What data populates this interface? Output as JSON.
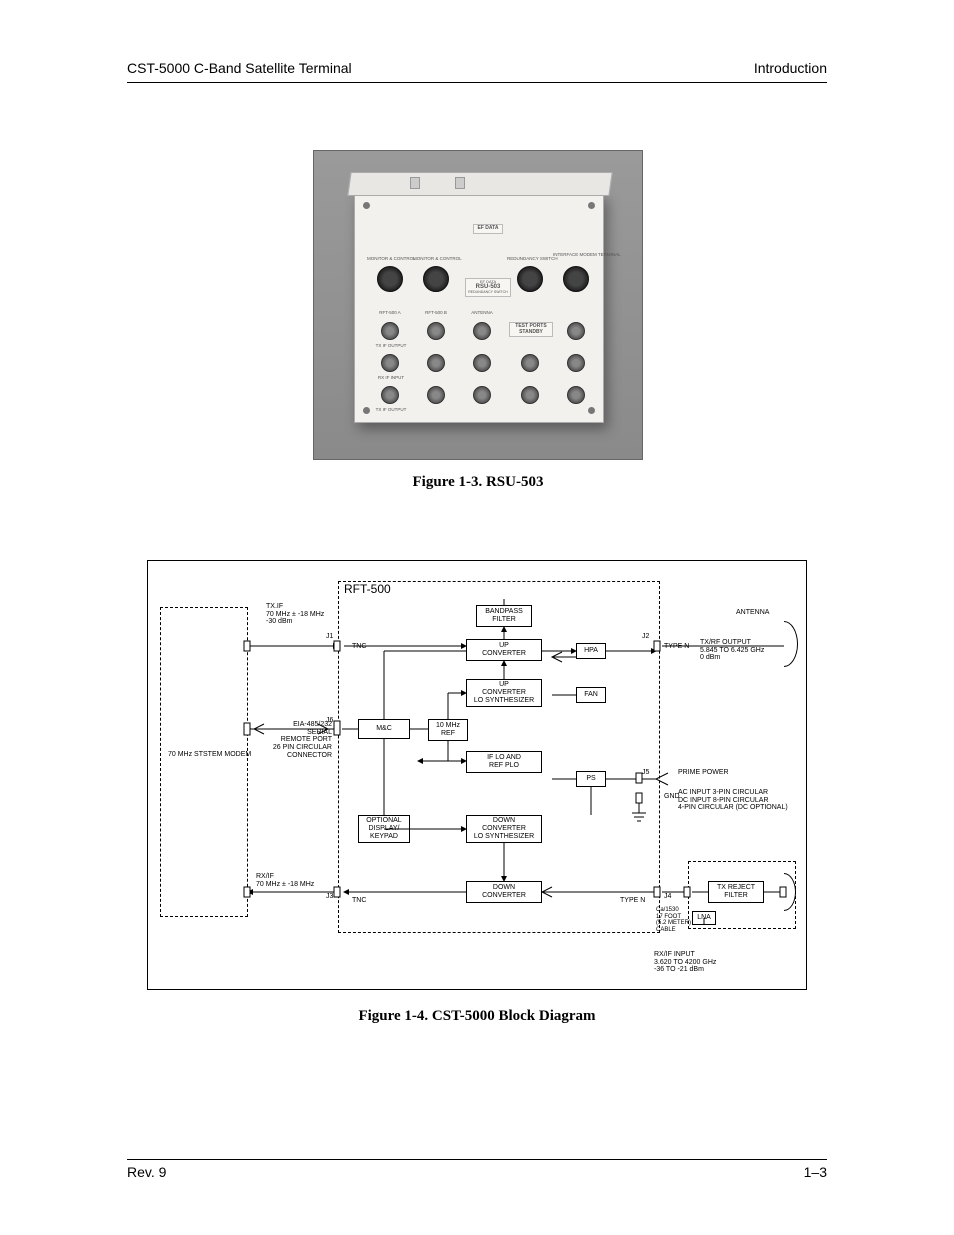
{
  "header": {
    "left": "CST-5000 C-Band Satellite Terminal",
    "right": "Introduction"
  },
  "figure1": {
    "caption": "Figure 1-3.  RSU-503",
    "device": {
      "brand": "EF DATA",
      "model": "RSU-503",
      "subtitle": "REDUNDANCY SWITCH",
      "cols": {
        "a": "RFT-500  A",
        "b": "RFT-500  B",
        "ant": "ANTENNA",
        "tp": "TEST PORTS STANDBY",
        "if1": "INTERFACE MODEM TERMINAL",
        "if2": ""
      },
      "rows": {
        "tx": "TX  IF OUTPUT",
        "rx": "RX  IF INPUT",
        "txo": "TX  IF OUTPUT",
        "mc": "MONITOR & CONTROL"
      }
    }
  },
  "figure2": {
    "caption": "Figure 1-4.  CST-5000 Block Diagram",
    "title": "RFT-500",
    "left": {
      "modem": "70 MHz STSTEM MODEM",
      "txif": "TX.IF\n70 MHz ± -18 MHz\n-30 dBm",
      "serial": "EIA-485/232\nSERIAL\nREMOTE PORT\n26 PIN CIRCULAR\nCONNECTOR",
      "rxif": "RX/IF\n70 MHz ± -18 MHz"
    },
    "blocks": {
      "bpf": "BANDPASS\nFILTER",
      "upc": "UP\nCONVERTER",
      "upsyn": "UP\nCONVERTER\nLO SYNTHESIZER",
      "mc": "M&C",
      "ref": "10 MHz\nREF",
      "iflo": "IF LO AND\nREF PLO",
      "disp": "OPTIONAL\nDISPLAY/\nKEYPAD",
      "dnsyn": "DOWN\nCONVERTER\nLO SYNTHESIZER",
      "dnc": "DOWN\nCONVERTER",
      "hpa": "HPA",
      "fan": "FAN",
      "ps": "PS",
      "txrej": "TX REJECT\nFILTER",
      "lna": "LNA"
    },
    "conn": {
      "j1": "J1",
      "j2": "J2",
      "j3": "J3",
      "j4": "J4",
      "j5": "J5",
      "j6": "J6",
      "tnc": "TNC",
      "typen": "TYPE N",
      "gnd": "GND"
    },
    "right": {
      "ant": "ANTENNA",
      "txrf": "TX/RF OUTPUT\n5.845 TO 6.425 GHz\n0 dBm",
      "prime": "PRIME POWER",
      "ac": "AC INPUT 3-PIN CIRCULAR\nDC INPUT 8-PIN CIRCULAR\n4-PIN CIRCULAR (DC OPTIONAL)",
      "cable": "Ca/1530\n17 FOOT\n(5.2 METER)\nCABLE",
      "rxrf": "RX/IF INPUT\n3.620 TO 4200 GHz\n-36 TO -21 dBm"
    }
  },
  "footer": {
    "left": "Rev. 9",
    "right": "1–3"
  }
}
